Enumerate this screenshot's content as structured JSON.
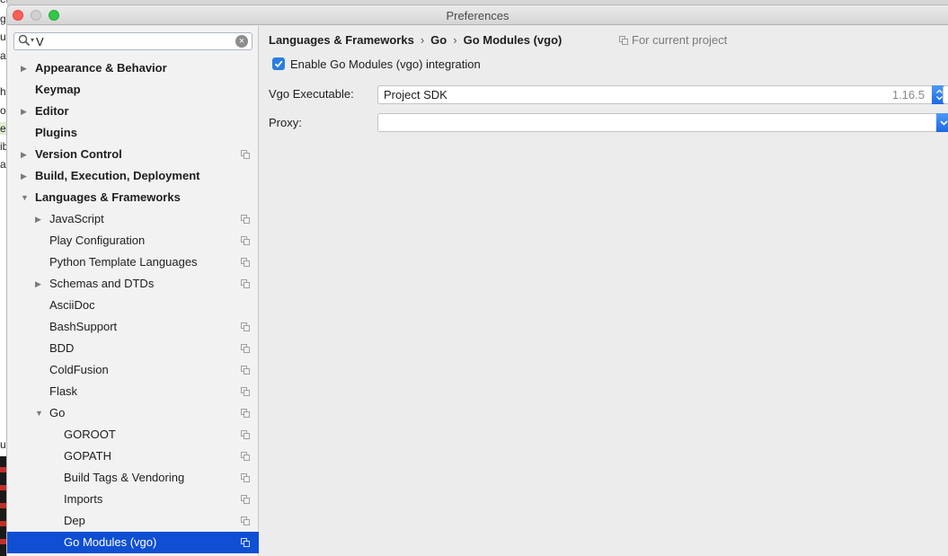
{
  "window": {
    "title": "Preferences"
  },
  "search": {
    "value": "V"
  },
  "background_fragments": [
    "ents",
    "ge",
    "u",
    "al",
    "h",
    "o",
    "es",
    "ib",
    "a",
    "ui"
  ],
  "sidebar": {
    "items": [
      {
        "label": "Appearance & Behavior",
        "level": 0,
        "bold": true,
        "expandable": true,
        "expanded": false,
        "project_icon": false
      },
      {
        "label": "Keymap",
        "level": 0,
        "bold": true,
        "expandable": false,
        "project_icon": false
      },
      {
        "label": "Editor",
        "level": 0,
        "bold": true,
        "expandable": true,
        "expanded": false,
        "project_icon": false
      },
      {
        "label": "Plugins",
        "level": 0,
        "bold": true,
        "expandable": false,
        "project_icon": false
      },
      {
        "label": "Version Control",
        "level": 0,
        "bold": true,
        "expandable": true,
        "expanded": false,
        "project_icon": true
      },
      {
        "label": "Build, Execution, Deployment",
        "level": 0,
        "bold": true,
        "expandable": true,
        "expanded": false,
        "project_icon": false
      },
      {
        "label": "Languages & Frameworks",
        "level": 0,
        "bold": true,
        "expandable": true,
        "expanded": true,
        "project_icon": false
      },
      {
        "label": "JavaScript",
        "level": 1,
        "bold": false,
        "expandable": true,
        "expanded": false,
        "project_icon": true
      },
      {
        "label": "Play Configuration",
        "level": 1,
        "bold": false,
        "expandable": false,
        "project_icon": true
      },
      {
        "label": "Python Template Languages",
        "level": 1,
        "bold": false,
        "expandable": false,
        "project_icon": true
      },
      {
        "label": "Schemas and DTDs",
        "level": 1,
        "bold": false,
        "expandable": true,
        "expanded": false,
        "project_icon": true
      },
      {
        "label": "AsciiDoc",
        "level": 1,
        "bold": false,
        "expandable": false,
        "project_icon": false
      },
      {
        "label": "BashSupport",
        "level": 1,
        "bold": false,
        "expandable": false,
        "project_icon": true
      },
      {
        "label": "BDD",
        "level": 1,
        "bold": false,
        "expandable": false,
        "project_icon": true
      },
      {
        "label": "ColdFusion",
        "level": 1,
        "bold": false,
        "expandable": false,
        "project_icon": true
      },
      {
        "label": "Flask",
        "level": 1,
        "bold": false,
        "expandable": false,
        "project_icon": true
      },
      {
        "label": "Go",
        "level": 1,
        "bold": false,
        "expandable": true,
        "expanded": true,
        "project_icon": true
      },
      {
        "label": "GOROOT",
        "level": 2,
        "bold": false,
        "expandable": false,
        "project_icon": true
      },
      {
        "label": "GOPATH",
        "level": 2,
        "bold": false,
        "expandable": false,
        "project_icon": true
      },
      {
        "label": "Build Tags & Vendoring",
        "level": 2,
        "bold": false,
        "expandable": false,
        "project_icon": true
      },
      {
        "label": "Imports",
        "level": 2,
        "bold": false,
        "expandable": false,
        "project_icon": true
      },
      {
        "label": "Dep",
        "level": 2,
        "bold": false,
        "expandable": false,
        "project_icon": true
      },
      {
        "label": "Go Modules (vgo)",
        "level": 2,
        "bold": false,
        "expandable": false,
        "project_icon": true,
        "selected": true
      }
    ]
  },
  "content": {
    "breadcrumb": [
      "Languages & Frameworks",
      "Go",
      "Go Modules (vgo)"
    ],
    "breadcrumb_separator": "›",
    "scope_label": "For current project",
    "enable_checkbox": {
      "label": "Enable Go Modules (vgo) integration",
      "checked": true
    },
    "vgo_executable": {
      "label": "Vgo Executable:",
      "value": "Project SDK",
      "version": "1.16.5"
    },
    "proxy": {
      "label": "Proxy:",
      "value": ""
    }
  },
  "colors": {
    "selection": "#0f4fd3",
    "checkbox": "#2a7de1",
    "dropdown_button": "#1b68e3"
  }
}
